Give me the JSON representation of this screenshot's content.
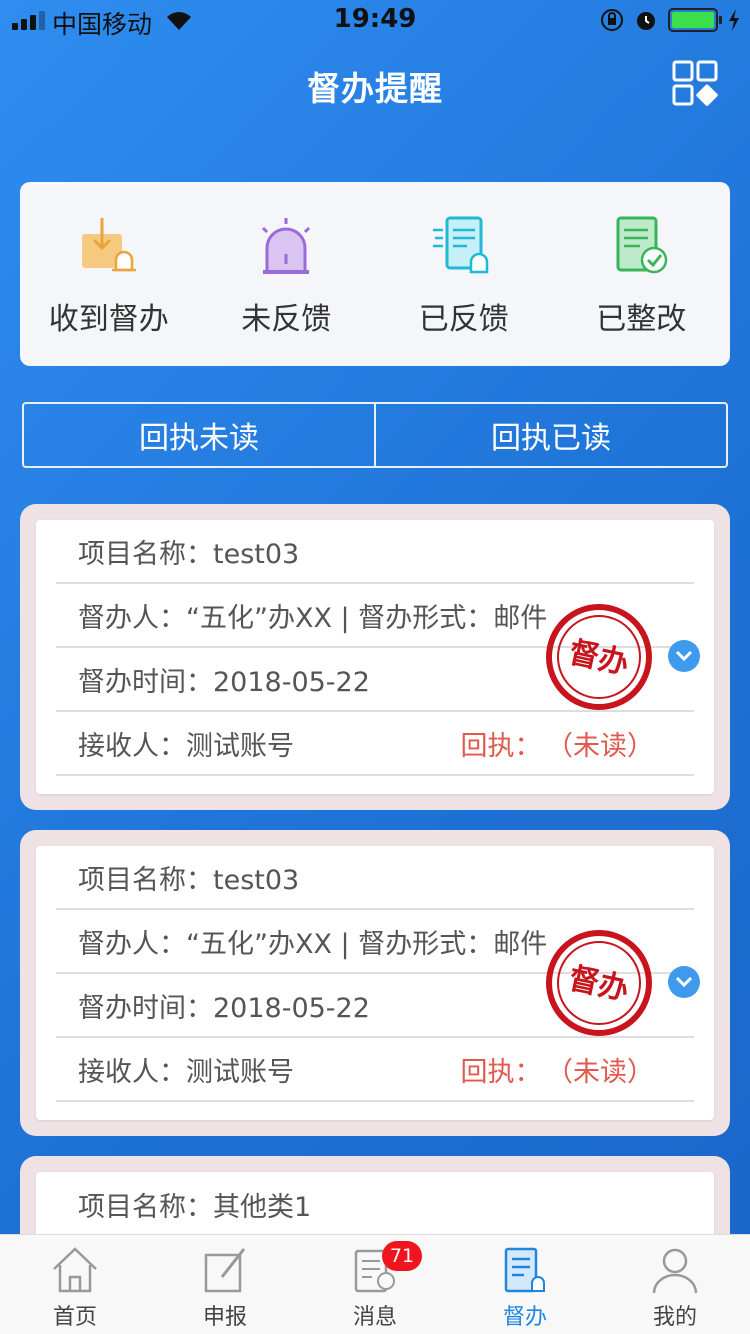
{
  "status": {
    "carrier": "中国移动",
    "time": "19:49"
  },
  "header": {
    "title": "督办提醒"
  },
  "stats": [
    {
      "label": "收到督办",
      "icon": "inbox-alarm-icon"
    },
    {
      "label": "未反馈",
      "icon": "siren-icon"
    },
    {
      "label": "已反馈",
      "icon": "document-alarm-icon"
    },
    {
      "label": "已整改",
      "icon": "document-check-icon"
    }
  ],
  "segment": {
    "left": "回执未读",
    "right": "回执已读"
  },
  "cards": [
    {
      "project": "项目名称：test03",
      "supervisor": "督办人：“五化”办XX | 督办形式：邮件",
      "time": "督办时间：2018-05-22",
      "receiver": "接收人：测试账号",
      "receipt_label": "回执：",
      "receipt_status": "（未读）",
      "stamp": "督办"
    },
    {
      "project": "项目名称：test03",
      "supervisor": "督办人：“五化”办XX | 督办形式：邮件",
      "time": "督办时间：2018-05-22",
      "receiver": "接收人：测试账号",
      "receipt_label": "回执：",
      "receipt_status": "（未读）",
      "stamp": "督办"
    },
    {
      "project": "项目名称：其他类1"
    }
  ],
  "tabs": [
    {
      "label": "首页",
      "icon": "home-icon"
    },
    {
      "label": "申报",
      "icon": "edit-icon"
    },
    {
      "label": "消息",
      "icon": "message-icon",
      "badge": "71"
    },
    {
      "label": "督办",
      "icon": "supervise-icon",
      "active": true
    },
    {
      "label": "我的",
      "icon": "user-icon"
    }
  ],
  "colors": {
    "accent": "#1f86e0",
    "alert": "#e05a4e",
    "stamp": "#c8141c",
    "badge": "#f0141e"
  }
}
